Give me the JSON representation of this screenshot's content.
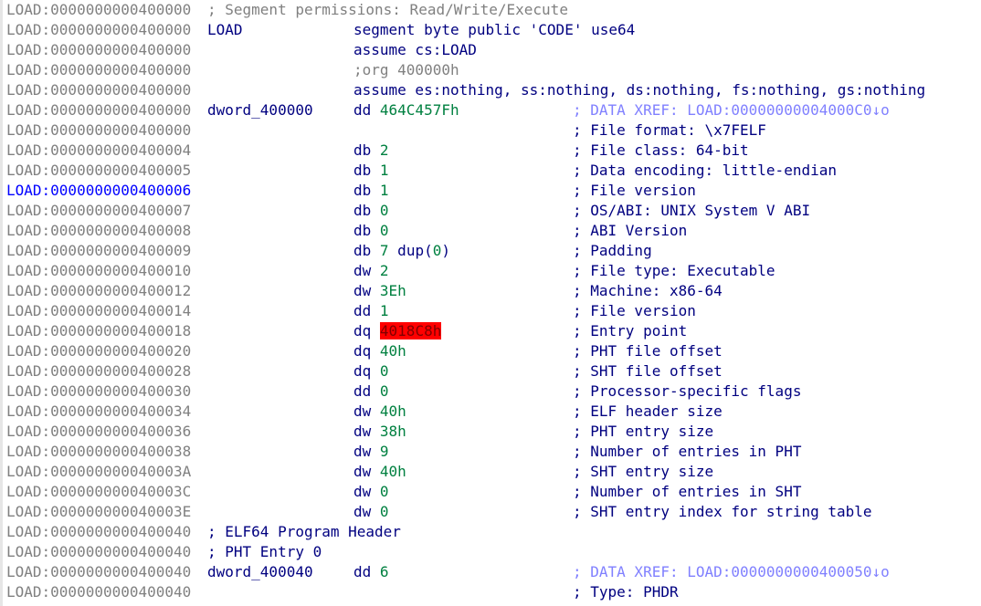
{
  "lines": [
    {
      "addr": "LOAD:0000000000400000",
      "label": "; Segment permissions: Read/Write/Execute",
      "label_style": "gray",
      "instr": "",
      "cmt": ""
    },
    {
      "addr": "LOAD:0000000000400000",
      "label": "LOAD",
      "instr": "segment byte public 'CODE' use64",
      "cmt": ""
    },
    {
      "addr": "LOAD:0000000000400000",
      "label": "",
      "instr": "assume cs:LOAD",
      "cmt": ""
    },
    {
      "addr": "LOAD:0000000000400000",
      "label": "",
      "instr": ";org 400000h",
      "instr_style": "gray",
      "cmt": ""
    },
    {
      "addr": "LOAD:0000000000400000",
      "label": "",
      "instr": "assume es:nothing, ss:nothing, ds:nothing, fs:nothing, gs:nothing",
      "cmt": ""
    },
    {
      "addr": "LOAD:0000000000400000",
      "label": "dword_400000",
      "mnem": "dd",
      "op": "464C457Fh",
      "cmt": "; DATA XREF: LOAD:00000000004000C0↓o",
      "cmt_style": "xref"
    },
    {
      "addr": "LOAD:0000000000400000",
      "label": "",
      "instr": "",
      "cmt": "; File format: \\x7FELF"
    },
    {
      "addr": "LOAD:0000000000400004",
      "label": "",
      "mnem": "db",
      "op": "2",
      "cmt": "; File class: 64-bit"
    },
    {
      "addr": "LOAD:0000000000400005",
      "label": "",
      "mnem": "db",
      "op": "1",
      "cmt": "; Data encoding: little-endian"
    },
    {
      "addr": "LOAD:0000000000400006",
      "label": "",
      "mnem": "db",
      "op": "1",
      "cmt": "; File version",
      "current": true
    },
    {
      "addr": "LOAD:0000000000400007",
      "label": "",
      "mnem": "db",
      "op": "0",
      "cmt": "; OS/ABI: UNIX System V ABI"
    },
    {
      "addr": "LOAD:0000000000400008",
      "label": "",
      "mnem": "db",
      "op": "0",
      "cmt": "; ABI Version"
    },
    {
      "addr": "LOAD:0000000000400009",
      "label": "",
      "mnem": "db",
      "op": "7",
      "op_tail": "dup(0)",
      "cmt": "; Padding"
    },
    {
      "addr": "LOAD:0000000000400010",
      "label": "",
      "mnem": "dw",
      "op": "2",
      "cmt": "; File type: Executable"
    },
    {
      "addr": "LOAD:0000000000400012",
      "label": "",
      "mnem": "dw",
      "op": "3Eh",
      "cmt": "; Machine: x86-64"
    },
    {
      "addr": "LOAD:0000000000400014",
      "label": "",
      "mnem": "dd",
      "op": "1",
      "cmt": "; File version"
    },
    {
      "addr": "LOAD:0000000000400018",
      "label": "",
      "mnem": "dq",
      "op": "4018C8h",
      "op_style": "hl",
      "cmt": "; Entry point"
    },
    {
      "addr": "LOAD:0000000000400020",
      "label": "",
      "mnem": "dq",
      "op": "40h",
      "cmt": "; PHT file offset"
    },
    {
      "addr": "LOAD:0000000000400028",
      "label": "",
      "mnem": "dq",
      "op": "0",
      "cmt": "; SHT file offset"
    },
    {
      "addr": "LOAD:0000000000400030",
      "label": "",
      "mnem": "dd",
      "op": "0",
      "cmt": "; Processor-specific flags"
    },
    {
      "addr": "LOAD:0000000000400034",
      "label": "",
      "mnem": "dw",
      "op": "40h",
      "cmt": "; ELF header size"
    },
    {
      "addr": "LOAD:0000000000400036",
      "label": "",
      "mnem": "dw",
      "op": "38h",
      "cmt": "; PHT entry size"
    },
    {
      "addr": "LOAD:0000000000400038",
      "label": "",
      "mnem": "dw",
      "op": "9",
      "cmt": "; Number of entries in PHT"
    },
    {
      "addr": "LOAD:000000000040003A",
      "label": "",
      "mnem": "dw",
      "op": "40h",
      "cmt": "; SHT entry size"
    },
    {
      "addr": "LOAD:000000000040003C",
      "label": "",
      "mnem": "dw",
      "op": "0",
      "cmt": "; Number of entries in SHT"
    },
    {
      "addr": "LOAD:000000000040003E",
      "label": "",
      "mnem": "dw",
      "op": "0",
      "cmt": "; SHT entry index for string table"
    },
    {
      "addr": "LOAD:0000000000400040",
      "label": "; ELF64 Program Header",
      "instr": "",
      "cmt": ""
    },
    {
      "addr": "LOAD:0000000000400040",
      "label": "; PHT Entry 0",
      "instr": "",
      "cmt": ""
    },
    {
      "addr": "LOAD:0000000000400040",
      "label": "dword_400040",
      "label_offset": "shift",
      "mnem": "dd",
      "op": "6",
      "cmt": "; DATA XREF: LOAD:0000000000400050↓o",
      "cmt_style": "xref"
    },
    {
      "addr": "LOAD:0000000000400040",
      "label": "",
      "instr": "",
      "cmt": "; Type: PHDR"
    }
  ],
  "colors": {
    "address": "#808080",
    "address_current": "#0000ff",
    "keyword": "#000080",
    "number": "#008040",
    "xref_comment": "#8080ff",
    "highlight_bg": "#ff0000"
  }
}
